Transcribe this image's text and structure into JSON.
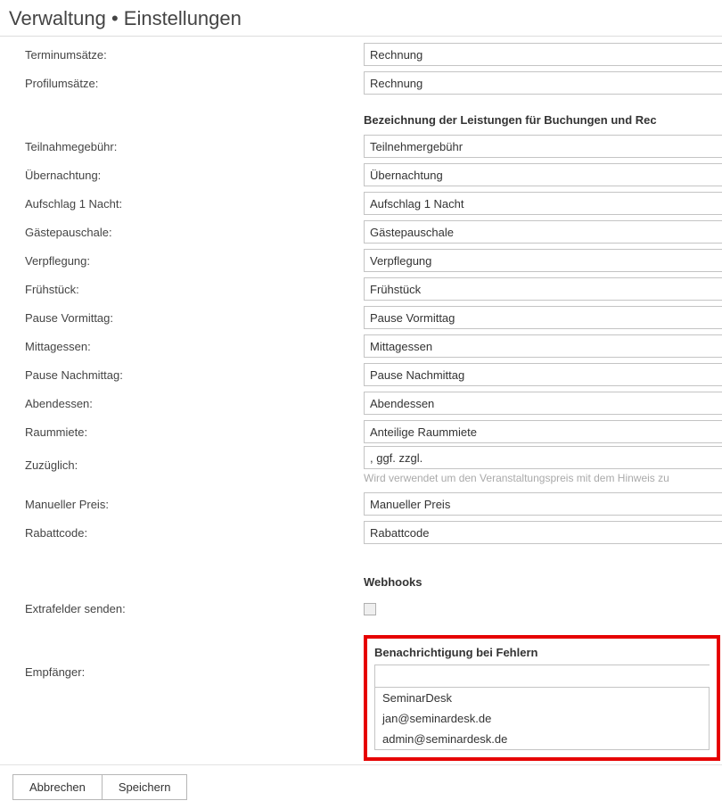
{
  "page": {
    "title": "Verwaltung • Einstellungen"
  },
  "labels": {
    "terminumsaetze": "Terminumsätze:",
    "profilumsaetze": "Profilumsätze:",
    "teilnahmegebuehr": "Teilnahmegebühr:",
    "uebernachtung": "Übernachtung:",
    "aufschlag1nacht": "Aufschlag 1 Nacht:",
    "gaestepauschale": "Gästepauschale:",
    "verpflegung": "Verpflegung:",
    "fruehstueck": "Frühstück:",
    "pause_vormittag": "Pause Vormittag:",
    "mittagessen": "Mittagessen:",
    "pause_nachmittag": "Pause Nachmittag:",
    "abendessen": "Abendessen:",
    "raummiete": "Raummiete:",
    "zuzueglich": "Zuzüglich:",
    "manueller_preis": "Manueller Preis:",
    "rabattcode": "Rabattcode:",
    "extrafelder_senden": "Extrafelder senden:",
    "empfaenger": "Empfänger:"
  },
  "sections": {
    "leistungen": "Bezeichnung der Leistungen für Buchungen und Rec",
    "webhooks": "Webhooks",
    "benachrichtigung": "Benachrichtigung bei Fehlern"
  },
  "values": {
    "terminumsaetze": "Rechnung",
    "profilumsaetze": "Rechnung",
    "teilnahmegebuehr": "Teilnehmergebühr",
    "uebernachtung": "Übernachtung",
    "aufschlag1nacht": "Aufschlag 1 Nacht",
    "gaestepauschale": "Gästepauschale",
    "verpflegung": "Verpflegung",
    "fruehstueck": "Frühstück",
    "pause_vormittag": "Pause Vormittag",
    "mittagessen": "Mittagessen",
    "pause_nachmittag": "Pause Nachmittag",
    "abendessen": "Abendessen",
    "raummiete": "Anteilige Raummiete",
    "zuzueglich": ", ggf. zzgl.",
    "manueller_preis": "Manueller Preis",
    "rabattcode": "Rabattcode",
    "empfaenger": ""
  },
  "hints": {
    "zuzueglich": "Wird verwendet um den Veranstaltungspreis mit dem Hinweis zu"
  },
  "dropdown": {
    "items": {
      "0": "SeminarDesk",
      "1": "jan@seminardesk.de",
      "2": "admin@seminardesk.de"
    }
  },
  "buttons": {
    "cancel": "Abbrechen",
    "save": "Speichern"
  },
  "checkboxes": {
    "extrafelder_senden": false
  }
}
